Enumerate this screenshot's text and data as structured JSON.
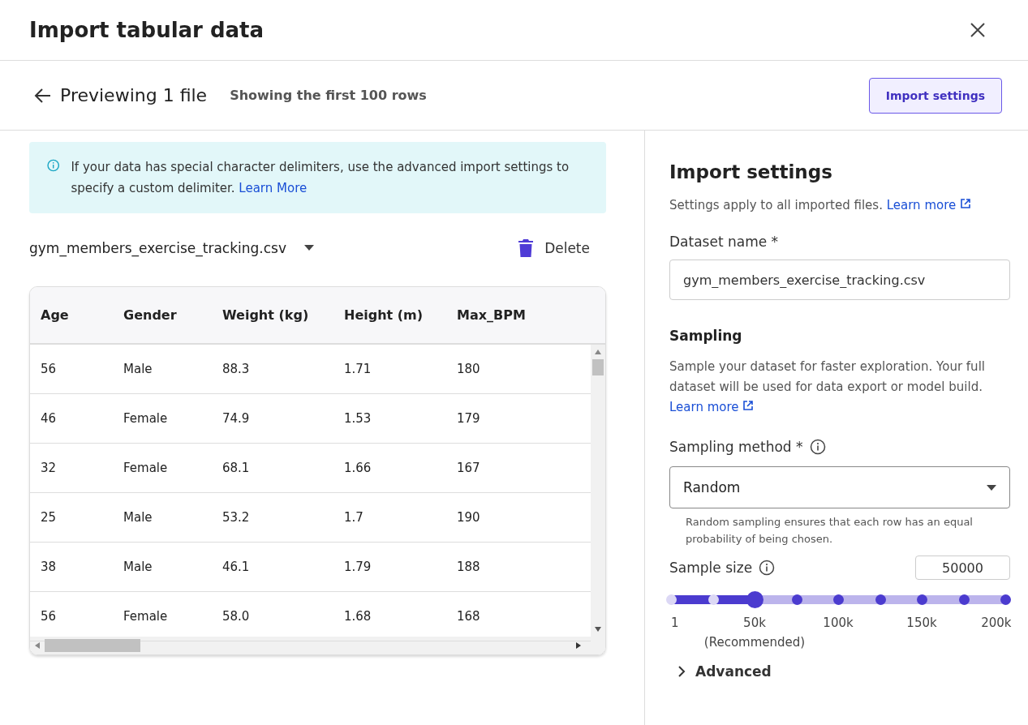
{
  "window": {
    "title": "Import tabular data"
  },
  "subheader": {
    "title": "Previewing 1 file",
    "caption": "Showing the first 100 rows",
    "button": "Import settings"
  },
  "notice": {
    "text": "If your data has special character delimiters, use the advanced import settings to specify a custom delimiter.",
    "link": "Learn More"
  },
  "file": {
    "name": "gym_members_exercise_tracking.csv",
    "delete": "Delete"
  },
  "table": {
    "columns": [
      "Age",
      "Gender",
      "Weight (kg)",
      "Height (m)",
      "Max_BPM"
    ],
    "rows": [
      [
        "56",
        "Male",
        "88.3",
        "1.71",
        "180"
      ],
      [
        "46",
        "Female",
        "74.9",
        "1.53",
        "179"
      ],
      [
        "32",
        "Female",
        "68.1",
        "1.66",
        "167"
      ],
      [
        "25",
        "Male",
        "53.2",
        "1.7",
        "190"
      ],
      [
        "38",
        "Male",
        "46.1",
        "1.79",
        "188"
      ],
      [
        "56",
        "Female",
        "58.0",
        "1.68",
        "168"
      ]
    ]
  },
  "settings": {
    "title": "Import settings",
    "description": "Settings apply to all imported files.",
    "link": "Learn more",
    "dataset_label": "Dataset name *",
    "dataset_value": "gym_members_exercise_tracking.csv",
    "sampling_title": "Sampling",
    "sampling_description": "Sample your dataset for faster exploration. Your full dataset will be used for data export or model build.",
    "sampling_link": "Learn more",
    "method_label": "Sampling method *",
    "method_value": "Random",
    "method_hint": "Random sampling ensures that each row has an equal probability of being chosen.",
    "size_label": "Sample size",
    "size_value": "50000",
    "level": 0.25,
    "ticks": [
      {
        "label": "1"
      },
      {
        "label": "50k",
        "note": "(Recommended)"
      },
      {
        "label": "100k"
      },
      {
        "label": "150k"
      },
      {
        "label": "200k"
      }
    ],
    "advanced": {
      "label": "Advanced",
      "expanded": false
    }
  }
}
